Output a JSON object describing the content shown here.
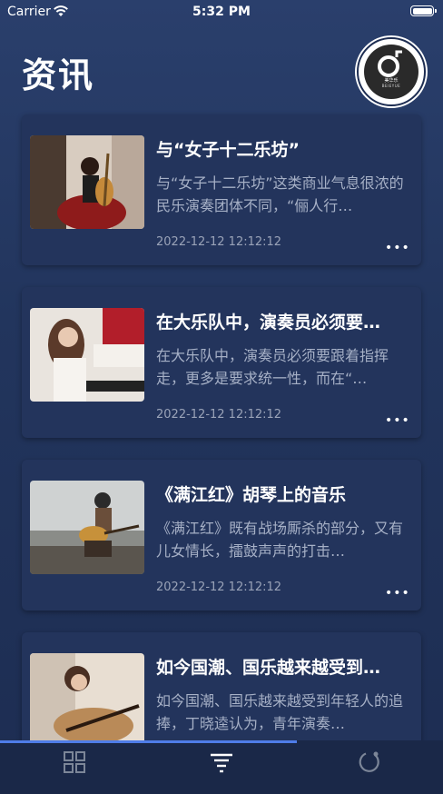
{
  "status": {
    "carrier": "Carrier",
    "time": "5:32 PM"
  },
  "header": {
    "title": "资讯",
    "logo": {
      "name": "美华乐",
      "sub": "BEIEYUE"
    }
  },
  "articles": [
    {
      "title": "与“女子十二乐坊”",
      "summary": "与“女子十二乐坊”这类商业气息很浓的民乐演奏团体不同，“俪人行…",
      "date": "2022-12-12 12:12:12",
      "more": "•••"
    },
    {
      "title": "在大乐队中，演奏员必须要…",
      "summary": "在大乐队中，演奏员必须要跟着指挥走，更多是要求统一性，而在“…",
      "date": "2022-12-12 12:12:12",
      "more": "•••"
    },
    {
      "title": "《满江红》胡琴上的音乐",
      "summary": "《满江红》既有战场厮杀的部分，又有儿女情长，擂鼓声声的打击…",
      "date": "2022-12-12 12:12:12",
      "more": "•••"
    },
    {
      "title": "如今国潮、国乐越来越受到…",
      "summary": "如今国潮、国乐越来越受到年轻人的追捧，丁晓逵认为，青年演奏…",
      "date": "",
      "more": ""
    }
  ],
  "tabbar": {
    "tabs": [
      {
        "icon": "grid-icon",
        "active": false
      },
      {
        "icon": "filter-list-icon",
        "active": true
      },
      {
        "icon": "circle-icon",
        "active": false
      }
    ],
    "progress": 0.67,
    "accent": "#4f7de8"
  }
}
